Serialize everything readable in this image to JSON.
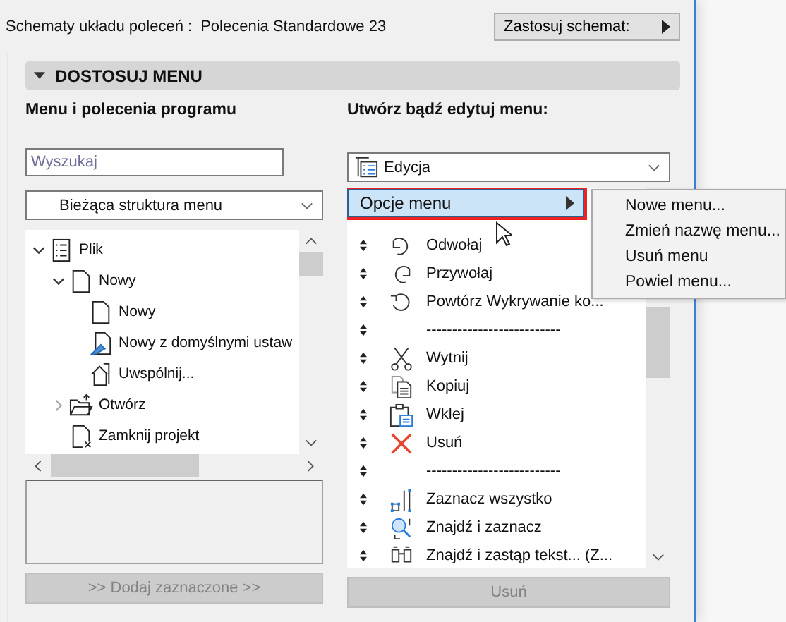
{
  "header": {
    "label": "Schematy układu poleceń :",
    "scheme": "Polecenia Standardowe 23",
    "apply_button": "Zastosuj schemat:"
  },
  "section": {
    "title": "DOSTOSUJ MENU",
    "expanded": true
  },
  "left": {
    "heading": "Menu i polecenia programu",
    "search": {
      "placeholder": "Wyszukaj"
    },
    "source_dropdown": "Bieżąca struktura menu",
    "tree": [
      {
        "label": "Plik",
        "expanded": true,
        "children": [
          {
            "label": "Nowy",
            "expanded": true,
            "children": [
              {
                "label": "Nowy"
              },
              {
                "label": "Nowy z domyślnymi ustaw"
              },
              {
                "label": "Uwspólnij..."
              }
            ]
          },
          {
            "label": "Otwórz",
            "expanded": false
          },
          {
            "label": "Zamknij projekt"
          }
        ]
      }
    ],
    "add_button": {
      "label": ">> Dodaj zaznaczone >>",
      "disabled": true
    }
  },
  "right": {
    "heading": "Utwórz bądź edytuj menu:",
    "menu_dropdown": "Edycja",
    "items": [
      {
        "kind": "submenu",
        "label": "Opcje menu",
        "selected": true
      },
      {
        "kind": "command",
        "label": "Odwołaj",
        "selected": false
      },
      {
        "kind": "command",
        "label": "Przywołaj",
        "selected": false
      },
      {
        "kind": "command",
        "label": "Powtórz Wykrywanie ko...",
        "selected": false
      },
      {
        "kind": "separator",
        "label": "--------------------------",
        "selected": false
      },
      {
        "kind": "command",
        "label": "Wytnij",
        "selected": false
      },
      {
        "kind": "command",
        "label": "Kopiuj",
        "selected": false
      },
      {
        "kind": "command",
        "label": "Wklej",
        "selected": false
      },
      {
        "kind": "command",
        "label": "Usuń",
        "selected": false
      },
      {
        "kind": "separator",
        "label": "--------------------------",
        "selected": false
      },
      {
        "kind": "command",
        "label": "Zaznacz wszystko",
        "selected": false
      },
      {
        "kind": "command",
        "label": "Znajdź i zaznacz",
        "selected": false
      },
      {
        "kind": "command",
        "label": "Znajdź i zastąp tekst... (Z...",
        "selected": false
      }
    ],
    "remove_button": {
      "label": "Usuń",
      "disabled": true
    }
  },
  "context_menu": [
    "Nowe menu...",
    "Zmień nazwę menu...",
    "Usuń menu",
    "Powiel menu..."
  ]
}
